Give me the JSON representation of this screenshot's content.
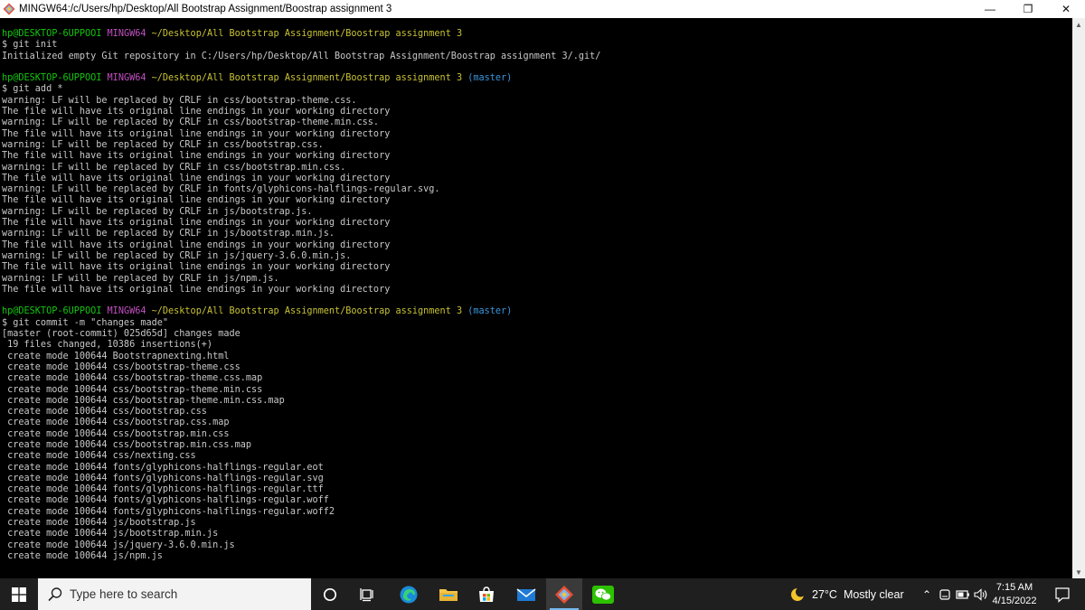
{
  "window": {
    "title": "MINGW64:/c/Users/hp/Desktop/All Bootstrap Assignment/Boostrap assignment 3",
    "controls": {
      "minimize": "—",
      "restore": "❐",
      "close": "✕"
    }
  },
  "terminal": {
    "lines": [
      [
        {
          "t": "hp@DESKTOP-6UPPOOI ",
          "c": "green"
        },
        {
          "t": "MINGW64 ",
          "c": "magenta"
        },
        {
          "t": "~/Desktop/All Bootstrap Assignment/Boostrap assignment 3",
          "c": "yellow"
        }
      ],
      [
        {
          "t": "$ git init",
          "c": "default"
        }
      ],
      [
        {
          "t": "Initialized empty Git repository in C:/Users/hp/Desktop/All Bootstrap Assignment/Boostrap assignment 3/.git/",
          "c": "default"
        }
      ],
      [
        {
          "t": "",
          "c": "default"
        }
      ],
      [
        {
          "t": "hp@DESKTOP-6UPPOOI ",
          "c": "green"
        },
        {
          "t": "MINGW64 ",
          "c": "magenta"
        },
        {
          "t": "~/Desktop/All Bootstrap Assignment/Boostrap assignment 3 ",
          "c": "yellow"
        },
        {
          "t": "(master)",
          "c": "cyan"
        }
      ],
      [
        {
          "t": "$ git add *",
          "c": "default"
        }
      ],
      [
        {
          "t": "warning: LF will be replaced by CRLF in css/bootstrap-theme.css.",
          "c": "default"
        }
      ],
      [
        {
          "t": "The file will have its original line endings in your working directory",
          "c": "default"
        }
      ],
      [
        {
          "t": "warning: LF will be replaced by CRLF in css/bootstrap-theme.min.css.",
          "c": "default"
        }
      ],
      [
        {
          "t": "The file will have its original line endings in your working directory",
          "c": "default"
        }
      ],
      [
        {
          "t": "warning: LF will be replaced by CRLF in css/bootstrap.css.",
          "c": "default"
        }
      ],
      [
        {
          "t": "The file will have its original line endings in your working directory",
          "c": "default"
        }
      ],
      [
        {
          "t": "warning: LF will be replaced by CRLF in css/bootstrap.min.css.",
          "c": "default"
        }
      ],
      [
        {
          "t": "The file will have its original line endings in your working directory",
          "c": "default"
        }
      ],
      [
        {
          "t": "warning: LF will be replaced by CRLF in fonts/glyphicons-halflings-regular.svg.",
          "c": "default"
        }
      ],
      [
        {
          "t": "The file will have its original line endings in your working directory",
          "c": "default"
        }
      ],
      [
        {
          "t": "warning: LF will be replaced by CRLF in js/bootstrap.js.",
          "c": "default"
        }
      ],
      [
        {
          "t": "The file will have its original line endings in your working directory",
          "c": "default"
        }
      ],
      [
        {
          "t": "warning: LF will be replaced by CRLF in js/bootstrap.min.js.",
          "c": "default"
        }
      ],
      [
        {
          "t": "The file will have its original line endings in your working directory",
          "c": "default"
        }
      ],
      [
        {
          "t": "warning: LF will be replaced by CRLF in js/jquery-3.6.0.min.js.",
          "c": "default"
        }
      ],
      [
        {
          "t": "The file will have its original line endings in your working directory",
          "c": "default"
        }
      ],
      [
        {
          "t": "warning: LF will be replaced by CRLF in js/npm.js.",
          "c": "default"
        }
      ],
      [
        {
          "t": "The file will have its original line endings in your working directory",
          "c": "default"
        }
      ],
      [
        {
          "t": "",
          "c": "default"
        }
      ],
      [
        {
          "t": "hp@DESKTOP-6UPPOOI ",
          "c": "green"
        },
        {
          "t": "MINGW64 ",
          "c": "magenta"
        },
        {
          "t": "~/Desktop/All Bootstrap Assignment/Boostrap assignment 3 ",
          "c": "yellow"
        },
        {
          "t": "(master)",
          "c": "cyan"
        }
      ],
      [
        {
          "t": "$ git commit -m \"changes made\"",
          "c": "default"
        }
      ],
      [
        {
          "t": "[master (root-commit) 025d65d] changes made",
          "c": "default"
        }
      ],
      [
        {
          "t": " 19 files changed, 10386 insertions(+)",
          "c": "default"
        }
      ],
      [
        {
          "t": " create mode 100644 Bootstrapnexting.html",
          "c": "default"
        }
      ],
      [
        {
          "t": " create mode 100644 css/bootstrap-theme.css",
          "c": "default"
        }
      ],
      [
        {
          "t": " create mode 100644 css/bootstrap-theme.css.map",
          "c": "default"
        }
      ],
      [
        {
          "t": " create mode 100644 css/bootstrap-theme.min.css",
          "c": "default"
        }
      ],
      [
        {
          "t": " create mode 100644 css/bootstrap-theme.min.css.map",
          "c": "default"
        }
      ],
      [
        {
          "t": " create mode 100644 css/bootstrap.css",
          "c": "default"
        }
      ],
      [
        {
          "t": " create mode 100644 css/bootstrap.css.map",
          "c": "default"
        }
      ],
      [
        {
          "t": " create mode 100644 css/bootstrap.min.css",
          "c": "default"
        }
      ],
      [
        {
          "t": " create mode 100644 css/bootstrap.min.css.map",
          "c": "default"
        }
      ],
      [
        {
          "t": " create mode 100644 css/nexting.css",
          "c": "default"
        }
      ],
      [
        {
          "t": " create mode 100644 fonts/glyphicons-halflings-regular.eot",
          "c": "default"
        }
      ],
      [
        {
          "t": " create mode 100644 fonts/glyphicons-halflings-regular.svg",
          "c": "default"
        }
      ],
      [
        {
          "t": " create mode 100644 fonts/glyphicons-halflings-regular.ttf",
          "c": "default"
        }
      ],
      [
        {
          "t": " create mode 100644 fonts/glyphicons-halflings-regular.woff",
          "c": "default"
        }
      ],
      [
        {
          "t": " create mode 100644 fonts/glyphicons-halflings-regular.woff2",
          "c": "default"
        }
      ],
      [
        {
          "t": " create mode 100644 js/bootstrap.js",
          "c": "default"
        }
      ],
      [
        {
          "t": " create mode 100644 js/bootstrap.min.js",
          "c": "default"
        }
      ],
      [
        {
          "t": " create mode 100644 js/jquery-3.6.0.min.js",
          "c": "default"
        }
      ],
      [
        {
          "t": " create mode 100644 js/npm.js",
          "c": "default"
        }
      ]
    ]
  },
  "taskbar": {
    "search_placeholder": "Type here to search",
    "weather": {
      "temp": "27°C",
      "condition": "Mostly clear"
    },
    "clock": {
      "time": "7:15 AM",
      "date": "4/15/2022"
    }
  },
  "colors": {
    "prompt_user": "#13c60e",
    "prompt_mingw": "#c250c2",
    "prompt_path": "#c8c234",
    "prompt_branch": "#3a96dd",
    "terminal_text": "#c8c8c8",
    "terminal_bg": "#000000",
    "taskbar_bg": "#1f1f1f"
  }
}
